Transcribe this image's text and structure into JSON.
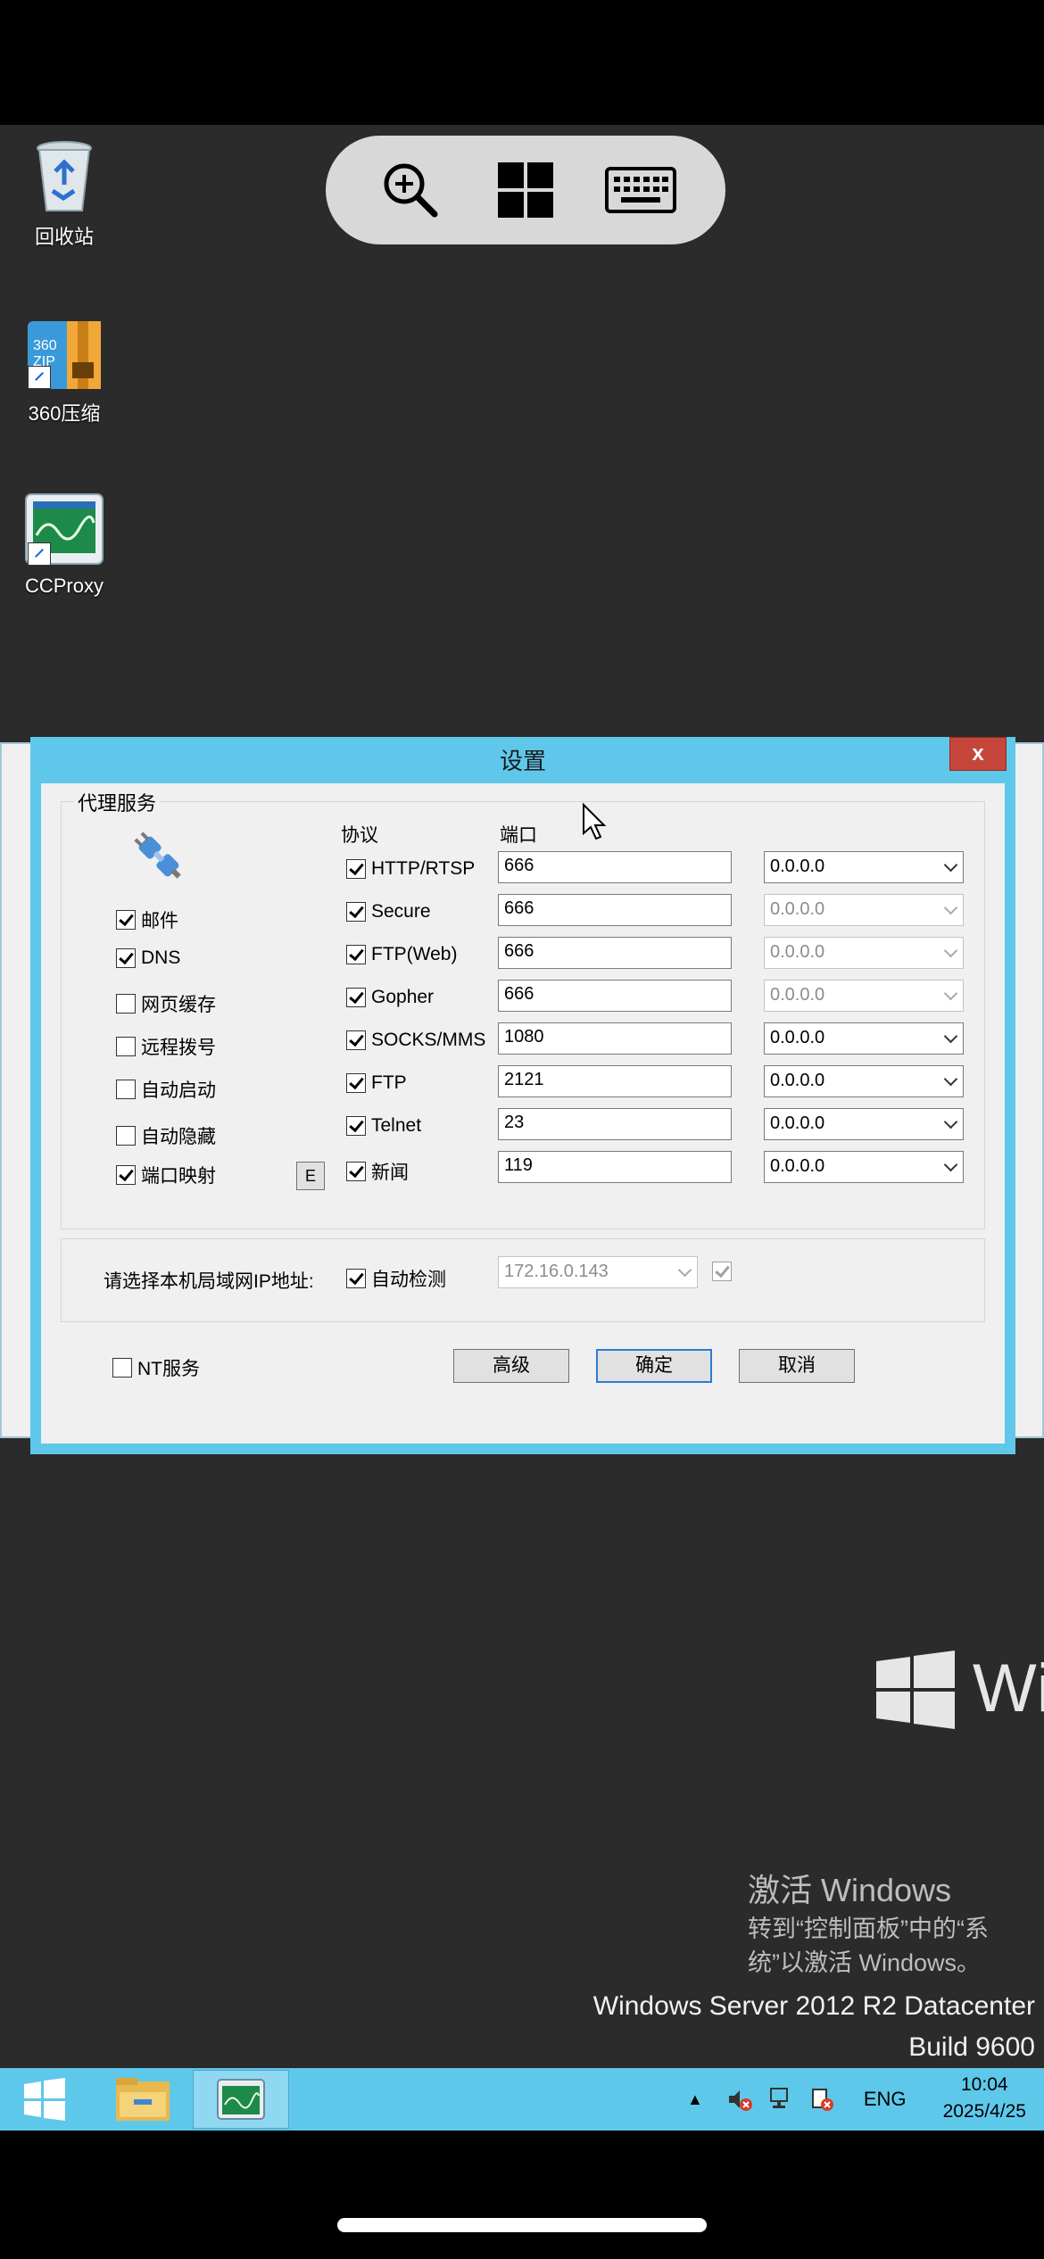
{
  "toolbar": {
    "zoom": "zoom-in",
    "windows": "windows",
    "keyboard": "keyboard"
  },
  "desktop_icons": [
    {
      "label": "回收站",
      "icon": "recycle-bin-icon"
    },
    {
      "label": "360压缩",
      "icon": "archive-icon"
    },
    {
      "label": "CCProxy",
      "icon": "ccproxy-icon"
    }
  ],
  "dialog": {
    "title": "设置",
    "close_label": "x",
    "group_title": "代理服务",
    "protocol_header": "协议",
    "port_header": "端口",
    "options": [
      {
        "label": "邮件",
        "checked": true
      },
      {
        "label": "DNS",
        "checked": true
      },
      {
        "label": "网页缓存",
        "checked": false
      },
      {
        "label": "远程拨号",
        "checked": false
      },
      {
        "label": "自动启动",
        "checked": false
      },
      {
        "label": "自动隐藏",
        "checked": false
      },
      {
        "label": "端口映射",
        "checked": true
      }
    ],
    "e_button": "E",
    "protocols": [
      {
        "name": "HTTP/RTSP",
        "checked": true,
        "port": "666",
        "ip": "0.0.0.0",
        "ip_disabled": false
      },
      {
        "name": "Secure",
        "checked": true,
        "port": "666",
        "ip": "0.0.0.0",
        "ip_disabled": true
      },
      {
        "name": "FTP(Web)",
        "checked": true,
        "port": "666",
        "ip": "0.0.0.0",
        "ip_disabled": true
      },
      {
        "name": "Gopher",
        "checked": true,
        "port": "666",
        "ip": "0.0.0.0",
        "ip_disabled": true
      },
      {
        "name": "SOCKS/MMS",
        "checked": true,
        "port": "1080",
        "ip": "0.0.0.0",
        "ip_disabled": false
      },
      {
        "name": "FTP",
        "checked": true,
        "port": "2121",
        "ip": "0.0.0.0",
        "ip_disabled": false
      },
      {
        "name": "Telnet",
        "checked": true,
        "port": "23",
        "ip": "0.0.0.0",
        "ip_disabled": false
      },
      {
        "name": "新闻",
        "checked": true,
        "port": "119",
        "ip": "0.0.0.0",
        "ip_disabled": false
      }
    ],
    "lan_label": "请选择本机局域网IP地址:",
    "auto_detect_label": "自动检测",
    "auto_detect_checked": true,
    "lan_ip": "172.16.0.143",
    "nt_service_label": "NT服务",
    "nt_service_checked": false,
    "buttons": {
      "advanced": "高级",
      "ok": "确定",
      "cancel": "取消"
    }
  },
  "watermark": {
    "activate_title": "激活 Windows",
    "activate_line1": "转到“控制面板”中的“系",
    "activate_line2": "统”以激活 Windows。",
    "edition": "Windows Server 2012 R2 Datacenter",
    "build": "Build 9600",
    "logo_text": "Wi"
  },
  "taskbar": {
    "tray_language": "ENG",
    "time": "10:04",
    "date": "2025/4/25"
  },
  "colors": {
    "accent": "#5ec8ea",
    "close": "#c7463c",
    "desktop": "#2b2b2b"
  }
}
